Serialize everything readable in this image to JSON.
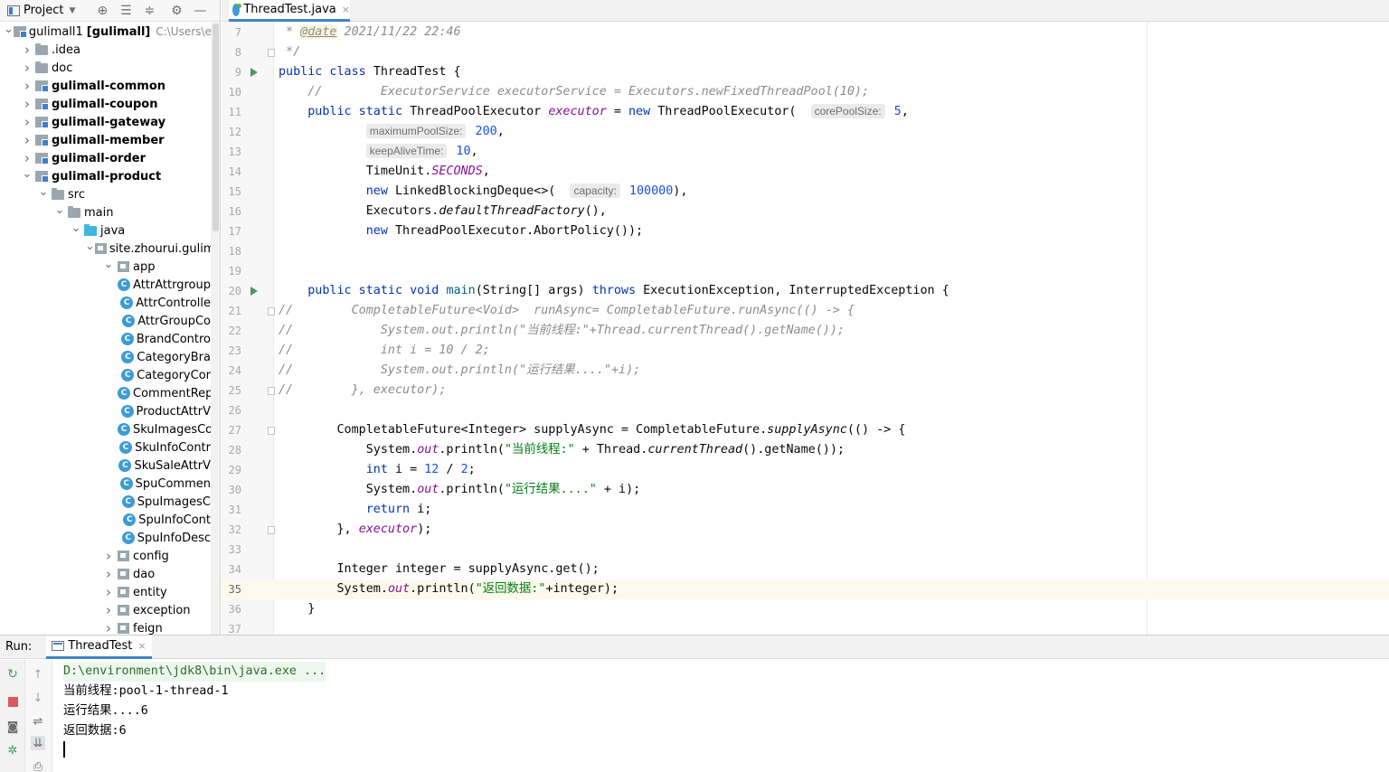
{
  "project_panel": {
    "title": "Project",
    "tree": [
      {
        "depth": 0,
        "arrow": "down",
        "icon": "module",
        "label": "gulimall1",
        "extra": "[gulimall]",
        "path": "C:\\Users\\eric",
        "bold": false
      },
      {
        "depth": 1,
        "arrow": "right",
        "icon": "folder",
        "label": ".idea",
        "bold": false
      },
      {
        "depth": 1,
        "arrow": "right",
        "icon": "folder",
        "label": "doc",
        "bold": false
      },
      {
        "depth": 1,
        "arrow": "right",
        "icon": "module",
        "label": "gulimall-common",
        "bold": true
      },
      {
        "depth": 1,
        "arrow": "right",
        "icon": "module",
        "label": "gulimall-coupon",
        "bold": true
      },
      {
        "depth": 1,
        "arrow": "right",
        "icon": "module",
        "label": "gulimall-gateway",
        "bold": true
      },
      {
        "depth": 1,
        "arrow": "right",
        "icon": "module",
        "label": "gulimall-member",
        "bold": true
      },
      {
        "depth": 1,
        "arrow": "right",
        "icon": "module",
        "label": "gulimall-order",
        "bold": true
      },
      {
        "depth": 1,
        "arrow": "down",
        "icon": "module",
        "label": "gulimall-product",
        "bold": true
      },
      {
        "depth": 2,
        "arrow": "down",
        "icon": "folder",
        "label": "src",
        "bold": false
      },
      {
        "depth": 3,
        "arrow": "down",
        "icon": "folder",
        "label": "main",
        "bold": false
      },
      {
        "depth": 4,
        "arrow": "down",
        "icon": "folder-blue",
        "label": "java",
        "bold": false
      },
      {
        "depth": 5,
        "arrow": "down",
        "icon": "package",
        "label": "site.zhourui.gulimal",
        "bold": false
      },
      {
        "depth": 6,
        "arrow": "down",
        "icon": "package",
        "label": "app",
        "bold": false
      },
      {
        "depth": 7,
        "arrow": "none",
        "icon": "class",
        "label": "AttrAttrgroup",
        "bold": false
      },
      {
        "depth": 7,
        "arrow": "none",
        "icon": "class",
        "label": "AttrControlle",
        "bold": false
      },
      {
        "depth": 7,
        "arrow": "none",
        "icon": "class",
        "label": "AttrGroupCo",
        "bold": false
      },
      {
        "depth": 7,
        "arrow": "none",
        "icon": "class",
        "label": "BrandContro",
        "bold": false
      },
      {
        "depth": 7,
        "arrow": "none",
        "icon": "class",
        "label": "CategoryBra",
        "bold": false
      },
      {
        "depth": 7,
        "arrow": "none",
        "icon": "class",
        "label": "CategoryCor",
        "bold": false
      },
      {
        "depth": 7,
        "arrow": "none",
        "icon": "class",
        "label": "CommentRep",
        "bold": false
      },
      {
        "depth": 7,
        "arrow": "none",
        "icon": "class",
        "label": "ProductAttrV",
        "bold": false
      },
      {
        "depth": 7,
        "arrow": "none",
        "icon": "class",
        "label": "SkuImagesCo",
        "bold": false
      },
      {
        "depth": 7,
        "arrow": "none",
        "icon": "class",
        "label": "SkuInfoContr",
        "bold": false
      },
      {
        "depth": 7,
        "arrow": "none",
        "icon": "class",
        "label": "SkuSaleAttrV",
        "bold": false
      },
      {
        "depth": 7,
        "arrow": "none",
        "icon": "class",
        "label": "SpuCommen",
        "bold": false
      },
      {
        "depth": 7,
        "arrow": "none",
        "icon": "class",
        "label": "SpuImagesC",
        "bold": false
      },
      {
        "depth": 7,
        "arrow": "none",
        "icon": "class",
        "label": "SpuInfoCont",
        "bold": false
      },
      {
        "depth": 7,
        "arrow": "none",
        "icon": "class",
        "label": "SpuInfoDesc",
        "bold": false
      },
      {
        "depth": 6,
        "arrow": "right",
        "icon": "package",
        "label": "config",
        "bold": false
      },
      {
        "depth": 6,
        "arrow": "right",
        "icon": "package",
        "label": "dao",
        "bold": false
      },
      {
        "depth": 6,
        "arrow": "right",
        "icon": "package",
        "label": "entity",
        "bold": false
      },
      {
        "depth": 6,
        "arrow": "right",
        "icon": "package",
        "label": "exception",
        "bold": false
      },
      {
        "depth": 6,
        "arrow": "right",
        "icon": "package",
        "label": "feign",
        "bold": false
      }
    ],
    "class_icon_letter": "C"
  },
  "editor": {
    "tab_label": "ThreadTest.java",
    "tab_close": "×",
    "current_line": 35,
    "lines": [
      {
        "n": "7",
        "mark": "",
        "tokens": [
          [
            "doc",
            " * "
          ],
          [
            "tag",
            "@date"
          ],
          [
            "doc",
            " 2021/11/22 22:46"
          ]
        ]
      },
      {
        "n": "8",
        "mark": "fold",
        "tokens": [
          [
            "doc",
            " */"
          ]
        ]
      },
      {
        "n": "9",
        "mark": "run",
        "tokens": [
          [
            "kw",
            "public class "
          ],
          [
            "",
            "ThreadTest {"
          ]
        ]
      },
      {
        "n": "10",
        "mark": "",
        "tokens": [
          [
            "cm",
            "    //        ExecutorService executorService = Executors.newFixedThreadPool(10);"
          ]
        ]
      },
      {
        "n": "11",
        "mark": "",
        "tokens": [
          [
            "kw",
            "    public static "
          ],
          [
            "",
            "ThreadPoolExecutor "
          ],
          [
            "fld",
            "executor"
          ],
          [
            "",
            " = "
          ],
          [
            "kw",
            "new "
          ],
          [
            "",
            "ThreadPoolExecutor(  "
          ],
          [
            "hint",
            "corePoolSize:"
          ],
          [
            "num",
            " 5"
          ],
          [
            "",
            ","
          ]
        ]
      },
      {
        "n": "12",
        "mark": "",
        "tokens": [
          [
            "",
            "            "
          ],
          [
            "hint",
            "maximumPoolSize:"
          ],
          [
            "num",
            " 200"
          ],
          [
            "",
            ","
          ]
        ]
      },
      {
        "n": "13",
        "mark": "",
        "tokens": [
          [
            "",
            "            "
          ],
          [
            "hint",
            "keepAliveTime:"
          ],
          [
            "num",
            " 10"
          ],
          [
            "",
            ","
          ]
        ]
      },
      {
        "n": "14",
        "mark": "",
        "tokens": [
          [
            "",
            "            TimeUnit."
          ],
          [
            "fld",
            "SECONDS"
          ],
          [
            "",
            ","
          ]
        ]
      },
      {
        "n": "15",
        "mark": "",
        "tokens": [
          [
            "kw",
            "            new "
          ],
          [
            "",
            "LinkedBlockingDeque<>(  "
          ],
          [
            "hint",
            "capacity:"
          ],
          [
            "num",
            " 100000"
          ],
          [
            "",
            "),"
          ]
        ]
      },
      {
        "n": "16",
        "mark": "",
        "tokens": [
          [
            "",
            "            Executors."
          ],
          [
            "sm",
            "defaultThreadFactory"
          ],
          [
            "",
            "(),"
          ]
        ]
      },
      {
        "n": "17",
        "mark": "",
        "tokens": [
          [
            "kw",
            "            new "
          ],
          [
            "",
            "ThreadPoolExecutor.AbortPolicy());"
          ]
        ]
      },
      {
        "n": "18",
        "mark": "",
        "tokens": []
      },
      {
        "n": "19",
        "mark": "",
        "tokens": []
      },
      {
        "n": "20",
        "mark": "run",
        "tokens": [
          [
            "kw",
            "    public static void "
          ],
          [
            "fn",
            "main"
          ],
          [
            "",
            "(String[] args) "
          ],
          [
            "kw",
            "throws "
          ],
          [
            "",
            "ExecutionException, InterruptedException {"
          ]
        ]
      },
      {
        "n": "21",
        "mark": "fold",
        "tokens": [
          [
            "cm",
            "//        CompletableFuture<Void>  runAsync= CompletableFuture.runAsync(() -> {"
          ]
        ]
      },
      {
        "n": "22",
        "mark": "",
        "tokens": [
          [
            "cm",
            "//            System.out.println(\"当前线程:\"+Thread.currentThread().getName());"
          ]
        ]
      },
      {
        "n": "23",
        "mark": "",
        "tokens": [
          [
            "cm",
            "//            int i = 10 / 2;"
          ]
        ]
      },
      {
        "n": "24",
        "mark": "",
        "tokens": [
          [
            "cm",
            "//            System.out.println(\"运行结果....\"+i);"
          ]
        ]
      },
      {
        "n": "25",
        "mark": "fold",
        "tokens": [
          [
            "cm",
            "//        }, executor);"
          ]
        ]
      },
      {
        "n": "26",
        "mark": "",
        "tokens": []
      },
      {
        "n": "27",
        "mark": "fold",
        "tokens": [
          [
            "",
            "        CompletableFuture<Integer> supplyAsync = CompletableFuture."
          ],
          [
            "sm",
            "supplyAsync"
          ],
          [
            "",
            "(() -> {"
          ]
        ]
      },
      {
        "n": "28",
        "mark": "",
        "tokens": [
          [
            "",
            "            System."
          ],
          [
            "fld",
            "out"
          ],
          [
            "",
            ".println("
          ],
          [
            "str",
            "\"当前线程:\""
          ],
          [
            "",
            " + Thread."
          ],
          [
            "sm",
            "currentThread"
          ],
          [
            "",
            "().getName());"
          ]
        ]
      },
      {
        "n": "29",
        "mark": "",
        "tokens": [
          [
            "kw",
            "            int "
          ],
          [
            "",
            "i = "
          ],
          [
            "num",
            "12"
          ],
          [
            "",
            " / "
          ],
          [
            "num",
            "2"
          ],
          [
            "",
            ";"
          ]
        ]
      },
      {
        "n": "30",
        "mark": "",
        "tokens": [
          [
            "",
            "            System."
          ],
          [
            "fld",
            "out"
          ],
          [
            "",
            ".println("
          ],
          [
            "str",
            "\"运行结果....\""
          ],
          [
            "",
            " + i);"
          ]
        ]
      },
      {
        "n": "31",
        "mark": "",
        "tokens": [
          [
            "kw",
            "            return "
          ],
          [
            "",
            "i;"
          ]
        ]
      },
      {
        "n": "32",
        "mark": "fold",
        "tokens": [
          [
            "",
            "        }, "
          ],
          [
            "fld",
            "executor"
          ],
          [
            "",
            ");"
          ]
        ]
      },
      {
        "n": "33",
        "mark": "",
        "tokens": []
      },
      {
        "n": "34",
        "mark": "",
        "tokens": [
          [
            "",
            "        Integer integer = supplyAsync.get();"
          ]
        ]
      },
      {
        "n": "35",
        "mark": "",
        "tokens": [
          [
            "",
            "        System."
          ],
          [
            "fld",
            "out"
          ],
          [
            "",
            ".println("
          ],
          [
            "str",
            "\"返回数据:\""
          ],
          [
            "",
            "+integer);"
          ]
        ]
      },
      {
        "n": "36",
        "mark": "",
        "tokens": [
          [
            "",
            "    }"
          ]
        ]
      },
      {
        "n": "37",
        "mark": "",
        "tokens": []
      }
    ]
  },
  "run_panel": {
    "label": "Run:",
    "tab_label": "ThreadTest",
    "tab_close": "×",
    "console": [
      {
        "text": "D:\\environment\\jdk8\\bin\\java.exe ...",
        "kind": "cmd"
      },
      {
        "text": "当前线程:pool-1-thread-1",
        "kind": "out"
      },
      {
        "text": "运行结果....6",
        "kind": "out"
      },
      {
        "text": "返回数据:6",
        "kind": "out"
      }
    ]
  }
}
